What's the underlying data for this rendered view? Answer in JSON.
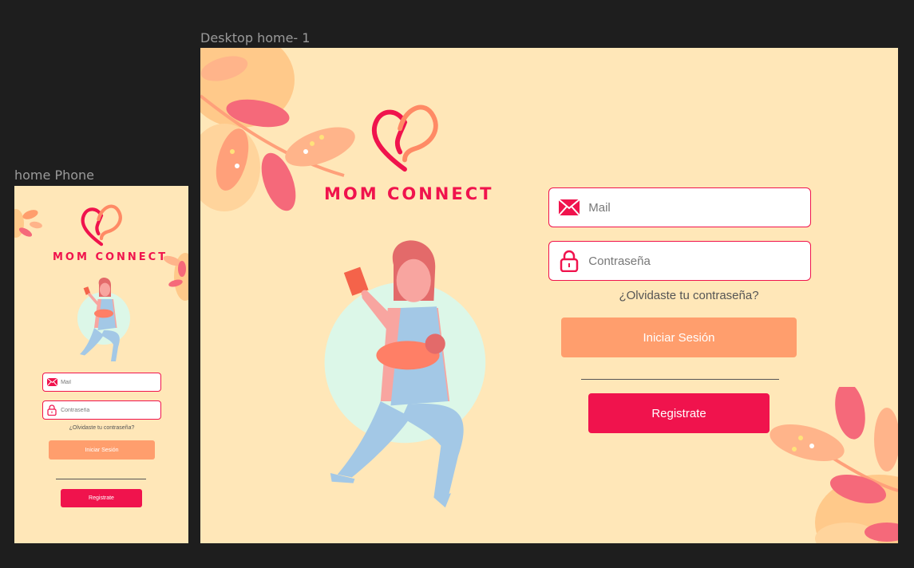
{
  "frames": {
    "phone_label": "home Phone",
    "desktop_label": "Desktop home- 1"
  },
  "brand": {
    "name": "MOM CONNECT",
    "colors": {
      "primary": "#f0134d",
      "accent": "#ff9e6d",
      "background": "#ffe7b8",
      "skin": "#f8a5a0",
      "dress": "#a3c8e6",
      "circle": "#dcf7e8"
    }
  },
  "form": {
    "mail_placeholder": "Mail",
    "password_placeholder": "Contraseña",
    "forgot_label": "¿Olvidaste tu contraseña?",
    "login_label": "Iniciar Sesión",
    "register_label": "Registrate"
  },
  "icons": {
    "mail": "envelope-icon",
    "password": "lock-icon",
    "logo": "heart-logo-icon"
  }
}
